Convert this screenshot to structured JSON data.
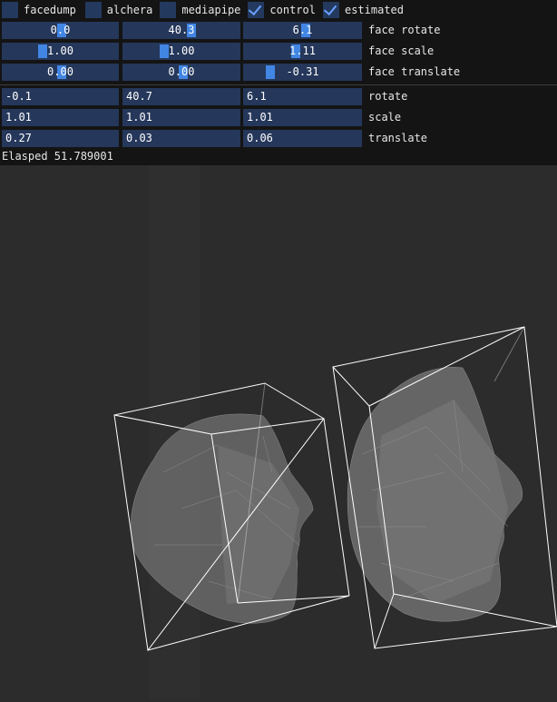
{
  "checkboxes": [
    {
      "label": "facedump",
      "checked": false
    },
    {
      "label": "alchera",
      "checked": false
    },
    {
      "label": "mediapipe",
      "checked": false
    },
    {
      "label": "control",
      "checked": true
    },
    {
      "label": "estimated",
      "checked": true
    }
  ],
  "face_rotate": {
    "label": "face rotate",
    "values": [
      "0.0",
      "40.3",
      "6.1"
    ]
  },
  "face_scale": {
    "label": "face scale",
    "values": [
      "1.00",
      "1.00",
      "1.11"
    ]
  },
  "face_translate": {
    "label": "face translate",
    "values": [
      "0.00",
      "0.00",
      "-0.31"
    ]
  },
  "rotate": {
    "label": "rotate",
    "values": [
      "-0.1",
      "40.7",
      "6.1"
    ]
  },
  "scale": {
    "label": "scale",
    "values": [
      "1.01",
      "1.01",
      "1.01"
    ]
  },
  "translate": {
    "label": "translate",
    "values": [
      "0.27",
      "0.03",
      "0.06"
    ]
  },
  "elapsed": "Elasped 51.789001",
  "colors": {
    "accent": "#4286e4",
    "field_bg": "#25375a",
    "panel_bg": "#141414",
    "viewport_bg": "#2c2c2c"
  }
}
